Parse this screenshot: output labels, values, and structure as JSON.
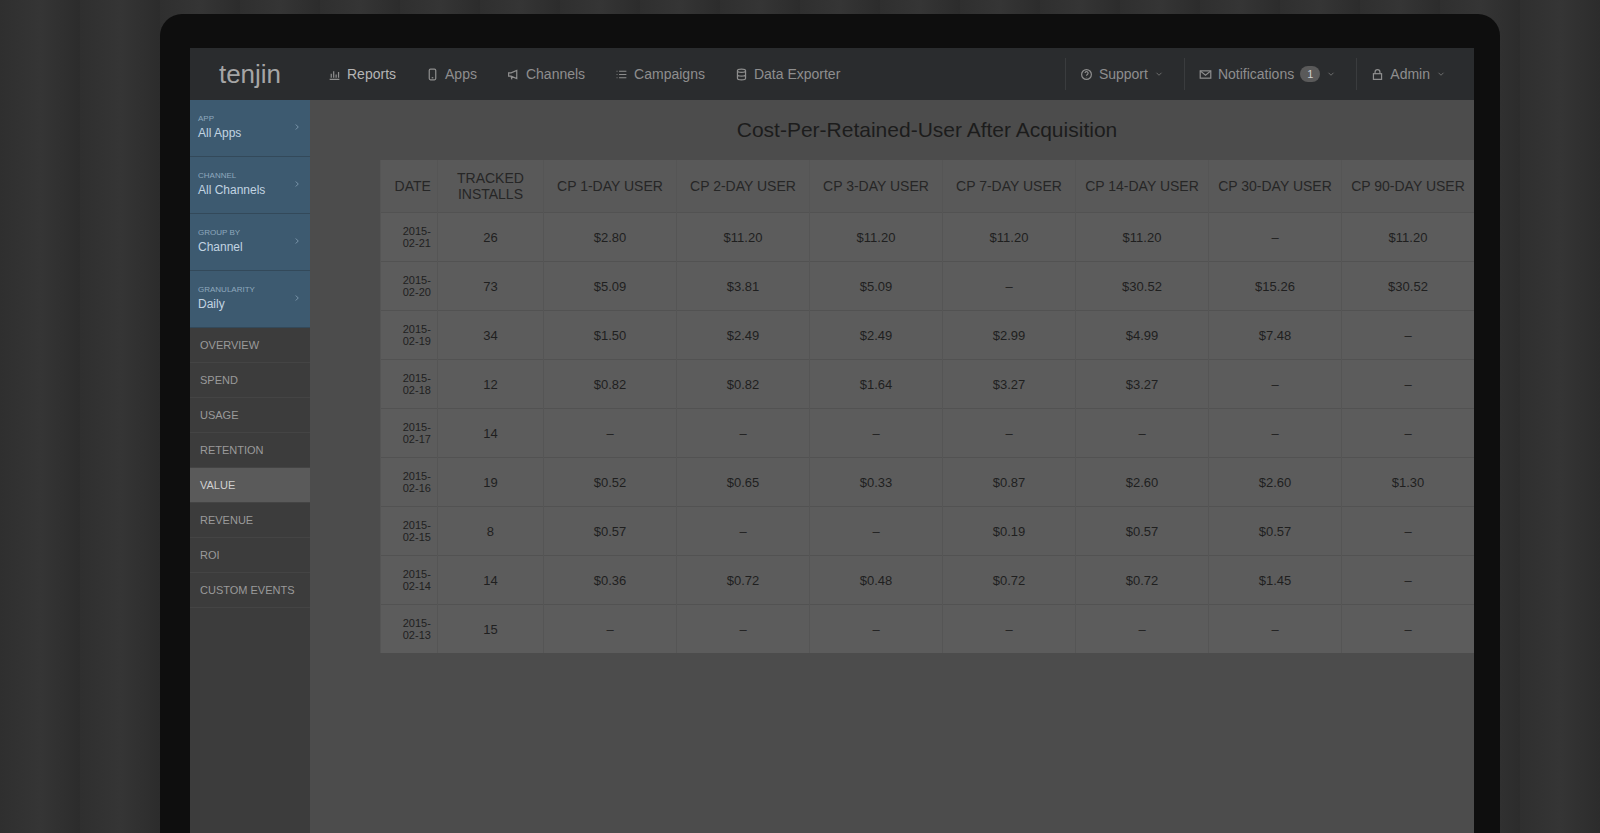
{
  "navbar": {
    "logo": "tenjin",
    "items": [
      {
        "label": "Reports",
        "selected": true
      },
      {
        "label": "Apps",
        "selected": false
      },
      {
        "label": "Channels",
        "selected": false
      },
      {
        "label": "Campaigns",
        "selected": false
      },
      {
        "label": "Data Exporter",
        "selected": false
      }
    ],
    "support": "Support",
    "notifications": "Notifications",
    "notification_count": "1",
    "user": "Admin"
  },
  "sidebar": {
    "filters": [
      {
        "label": "APP",
        "value": "All Apps"
      },
      {
        "label": "CHANNEL",
        "value": "All Channels"
      },
      {
        "label": "GROUP BY",
        "value": "Channel"
      },
      {
        "label": "GRANULARITY",
        "value": "Daily"
      }
    ],
    "items": [
      {
        "label": "OVERVIEW",
        "selected": false
      },
      {
        "label": "SPEND",
        "selected": false
      },
      {
        "label": "USAGE",
        "selected": false
      },
      {
        "label": "RETENTION",
        "selected": false
      },
      {
        "label": "VALUE",
        "selected": true
      },
      {
        "label": "REVENUE",
        "selected": false
      },
      {
        "label": "ROI",
        "selected": false
      },
      {
        "label": "CUSTOM EVENTS",
        "selected": false
      }
    ]
  },
  "report": {
    "title": "Cost-Per-Retained-User After Acquisition",
    "columns": [
      "DATE",
      "TRACKED INSTALLS",
      "CP 1-DAY USER",
      "CP 2-DAY USER",
      "CP 3-DAY USER",
      "CP 7-DAY USER",
      "CP 14-DAY USER",
      "CP 30-DAY USER",
      "CP 90-DAY USER"
    ],
    "rows": [
      [
        "2015-02-21",
        "26",
        "$2.80",
        "$11.20",
        "$11.20",
        "$11.20",
        "$11.20",
        "–",
        "$11.20"
      ],
      [
        "2015-02-20",
        "73",
        "$5.09",
        "$3.81",
        "$5.09",
        "–",
        "$30.52",
        "$15.26",
        "$30.52"
      ],
      [
        "2015-02-19",
        "34",
        "$1.50",
        "$2.49",
        "$2.49",
        "$2.99",
        "$4.99",
        "$7.48",
        "–"
      ],
      [
        "2015-02-18",
        "12",
        "$0.82",
        "$0.82",
        "$1.64",
        "$3.27",
        "$3.27",
        "–",
        "–"
      ],
      [
        "2015-02-17",
        "14",
        "–",
        "–",
        "–",
        "–",
        "–",
        "–",
        "–"
      ],
      [
        "2015-02-16",
        "19",
        "$0.52",
        "$0.65",
        "$0.33",
        "$0.87",
        "$2.60",
        "$2.60",
        "$1.30"
      ],
      [
        "2015-02-15",
        "8",
        "$0.57",
        "–",
        "–",
        "$0.19",
        "$0.57",
        "$0.57",
        "–"
      ],
      [
        "2015-02-14",
        "14",
        "$0.36",
        "$0.72",
        "$0.48",
        "$0.72",
        "$0.72",
        "$1.45",
        "–"
      ],
      [
        "2015-02-13",
        "15",
        "–",
        "–",
        "–",
        "–",
        "–",
        "–",
        "–"
      ]
    ]
  }
}
